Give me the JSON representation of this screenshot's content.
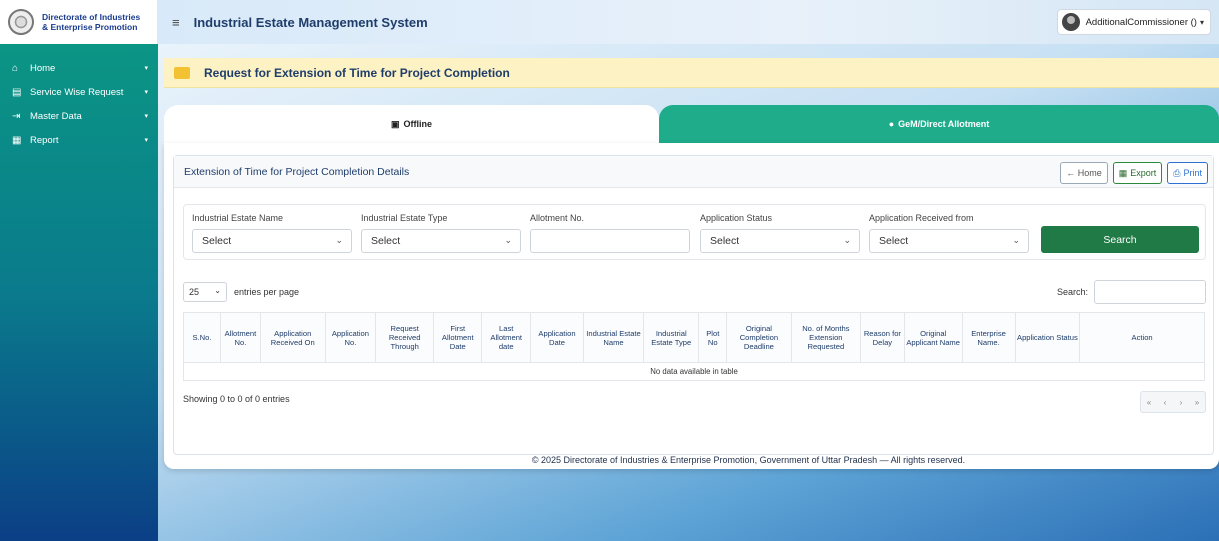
{
  "brand": {
    "line1": "Directorate of Industries",
    "line2": "& Enterprise Promotion"
  },
  "header": {
    "title": "Industrial Estate Management System",
    "user": "AdditionalCommissioner ()",
    "user_caret": "▾"
  },
  "sidebar": {
    "items": [
      {
        "icon": "⌂",
        "label": "Home",
        "caret": "▾"
      },
      {
        "icon": "▤",
        "label": "Service Wise Request",
        "caret": "▾"
      },
      {
        "icon": "⇥",
        "label": "Master Data",
        "caret": "▾"
      },
      {
        "icon": "▦",
        "label": "Report",
        "caret": "▾"
      }
    ]
  },
  "page": {
    "title": "Request for Extension of Time for Project Completion"
  },
  "tabs": [
    {
      "icon": "▣",
      "label": "Offline"
    },
    {
      "icon": "●",
      "label": "GeM/Direct Allotment"
    }
  ],
  "panel": {
    "title": "Extension of Time for Project Completion Details",
    "home_label": "← Home",
    "export_label": "Export",
    "print_label": "Print"
  },
  "filters": {
    "estate_name_label": "Industrial Estate Name",
    "estate_name_value": "Select",
    "estate_type_label": "Industrial Estate Type",
    "estate_type_value": "Select",
    "allotment_label": "Allotment No.",
    "status_label": "Application Status",
    "status_value": "Select",
    "received_from_label": "Application Received from",
    "received_from_value": "Select",
    "search_label": "Search"
  },
  "datatable": {
    "length_value": "25",
    "length_text": "entries per page",
    "search_label": "Search:",
    "columns": [
      "S.No.",
      "Allotment No.",
      "Application Received On",
      "Application No.",
      "Request Received Through",
      "First Allotment Date",
      "Last Allotment date",
      "Application Date",
      "Industrial Estate Name",
      "Industrial Estate Type",
      "Plot No",
      "Original Completion Deadline",
      "No. of Months Extension Requested",
      "Reason for Delay",
      "Original Applicant Name",
      "Enterprise Name.",
      "Application Status",
      "Action"
    ],
    "empty_text": "No data available in table",
    "info": "Showing 0 to 0 of 0 entries",
    "pager": [
      "«",
      "‹",
      "›",
      "»"
    ]
  },
  "footer": {
    "text": "© 2025 Directorate of Industries & Enterprise Promotion, Government of Uttar Pradesh — All rights reserved."
  },
  "colors": {
    "accent": "#1fac8b",
    "primary_dark": "#1f3d6b",
    "search_btn": "#1f7a45",
    "page_head_bg": "#fcf2c4"
  }
}
